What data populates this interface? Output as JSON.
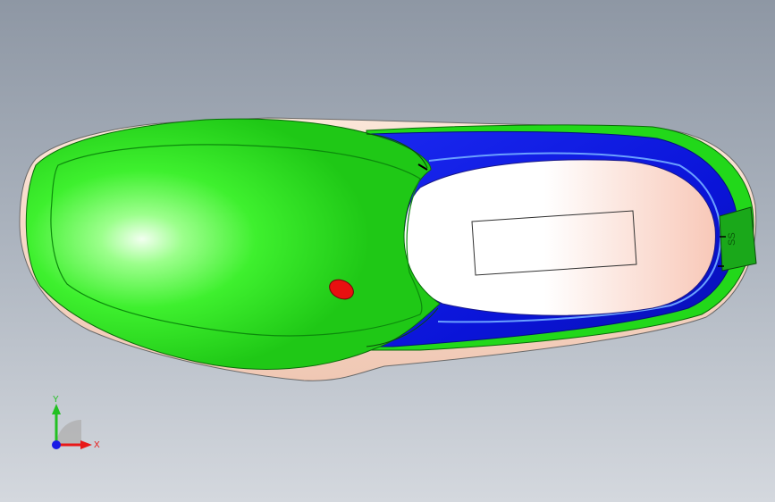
{
  "viewport": {
    "background_top": "#8e97a4",
    "background_bottom": "#d4d8de"
  },
  "model": {
    "upper_color": "#22e01a",
    "lining_color": "#0a1ae6",
    "insole_color": "#ffffff",
    "button_color": "#e81010"
  },
  "triad": {
    "x_label": "X",
    "y_label": "Y",
    "x_color": "#e81818",
    "y_color": "#22c022",
    "z_color": "#1a1ae6"
  }
}
